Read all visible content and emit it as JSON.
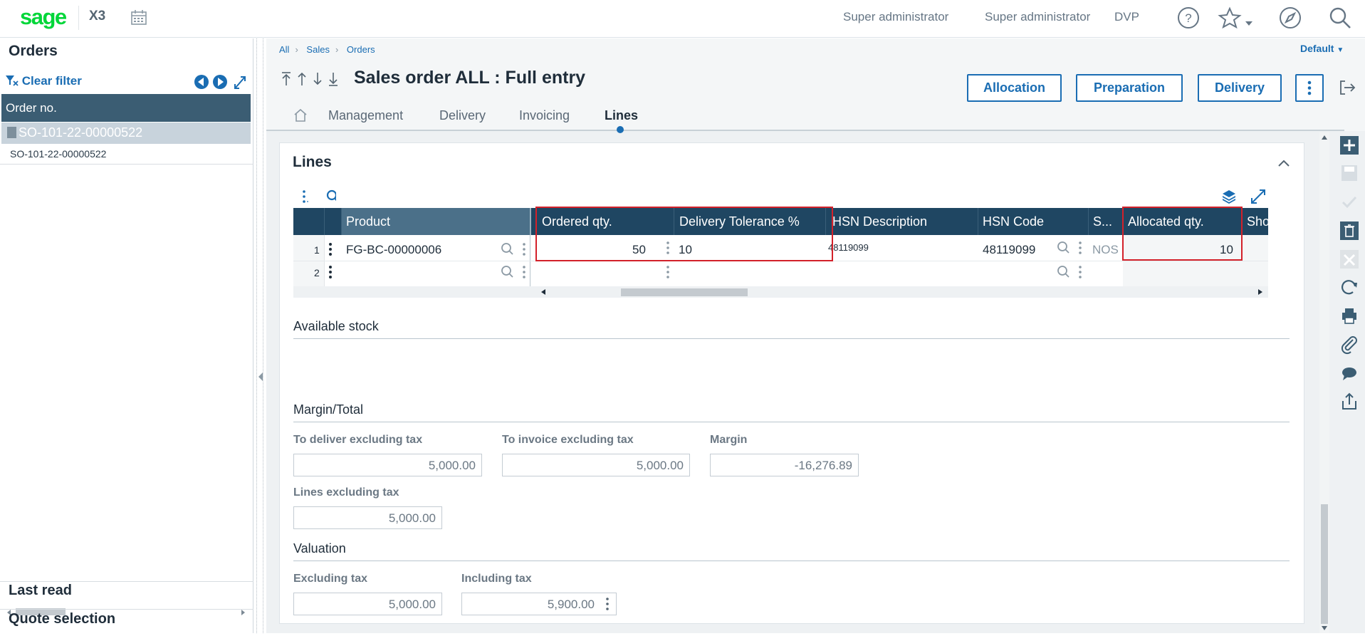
{
  "app": {
    "brand": "sage",
    "product": "X3"
  },
  "topbar": {
    "user1": "Super administrator",
    "user2": "Super administrator",
    "env": "DVP"
  },
  "left": {
    "title": "Orders",
    "clear_filter": "Clear filter",
    "column_header": "Order no.",
    "selected_item": "SO-101-22-00000522",
    "sub_item": "SO-101-22-00000522",
    "last_read": "Last read",
    "quote_selection": "Quote selection"
  },
  "breadcrumb": [
    "All",
    "Sales",
    "Orders"
  ],
  "default_label": "Default",
  "page_title": "Sales order ALL : Full entry",
  "actions": [
    "Allocation",
    "Preparation",
    "Delivery"
  ],
  "tabs": [
    {
      "label": "Management",
      "active": false
    },
    {
      "label": "Delivery",
      "active": false
    },
    {
      "label": "Invoicing",
      "active": false
    },
    {
      "label": "Lines",
      "active": true
    }
  ],
  "section_title": "Lines",
  "grid": {
    "columns": [
      "Product",
      "Ordered qty.",
      "Delivery Tolerance %",
      "HSN Description",
      "HSN Code",
      "S...",
      "Allocated qty.",
      "Sho"
    ],
    "rows": [
      {
        "num": "1",
        "product": "FG-BC-00000006",
        "ordered": "50",
        "tolerance": "10",
        "hsn_desc": "48119099",
        "hsn_code": "48119099",
        "s": "NOS",
        "allocated": "10"
      },
      {
        "num": "2",
        "product": "",
        "ordered": "",
        "tolerance": "",
        "hsn_desc": "",
        "hsn_code": "",
        "s": "",
        "allocated": ""
      }
    ]
  },
  "available_stock": {
    "title": "Available stock"
  },
  "margin_total": {
    "title": "Margin/Total",
    "to_deliver_label": "To deliver excluding tax",
    "to_deliver": "5,000.00",
    "to_invoice_label": "To invoice excluding tax",
    "to_invoice": "5,000.00",
    "margin_label": "Margin",
    "margin": "-16,276.89",
    "lines_excl_label": "Lines excluding tax",
    "lines_excl": "5,000.00"
  },
  "valuation": {
    "title": "Valuation",
    "excl_label": "Excluding tax",
    "excl": "5,000.00",
    "incl_label": "Including tax",
    "incl": "5,900.00"
  },
  "colors": {
    "brand": "#00d639",
    "accent": "#1a6db3",
    "grid_header": "#1f4662",
    "highlight": "#d3212a"
  }
}
